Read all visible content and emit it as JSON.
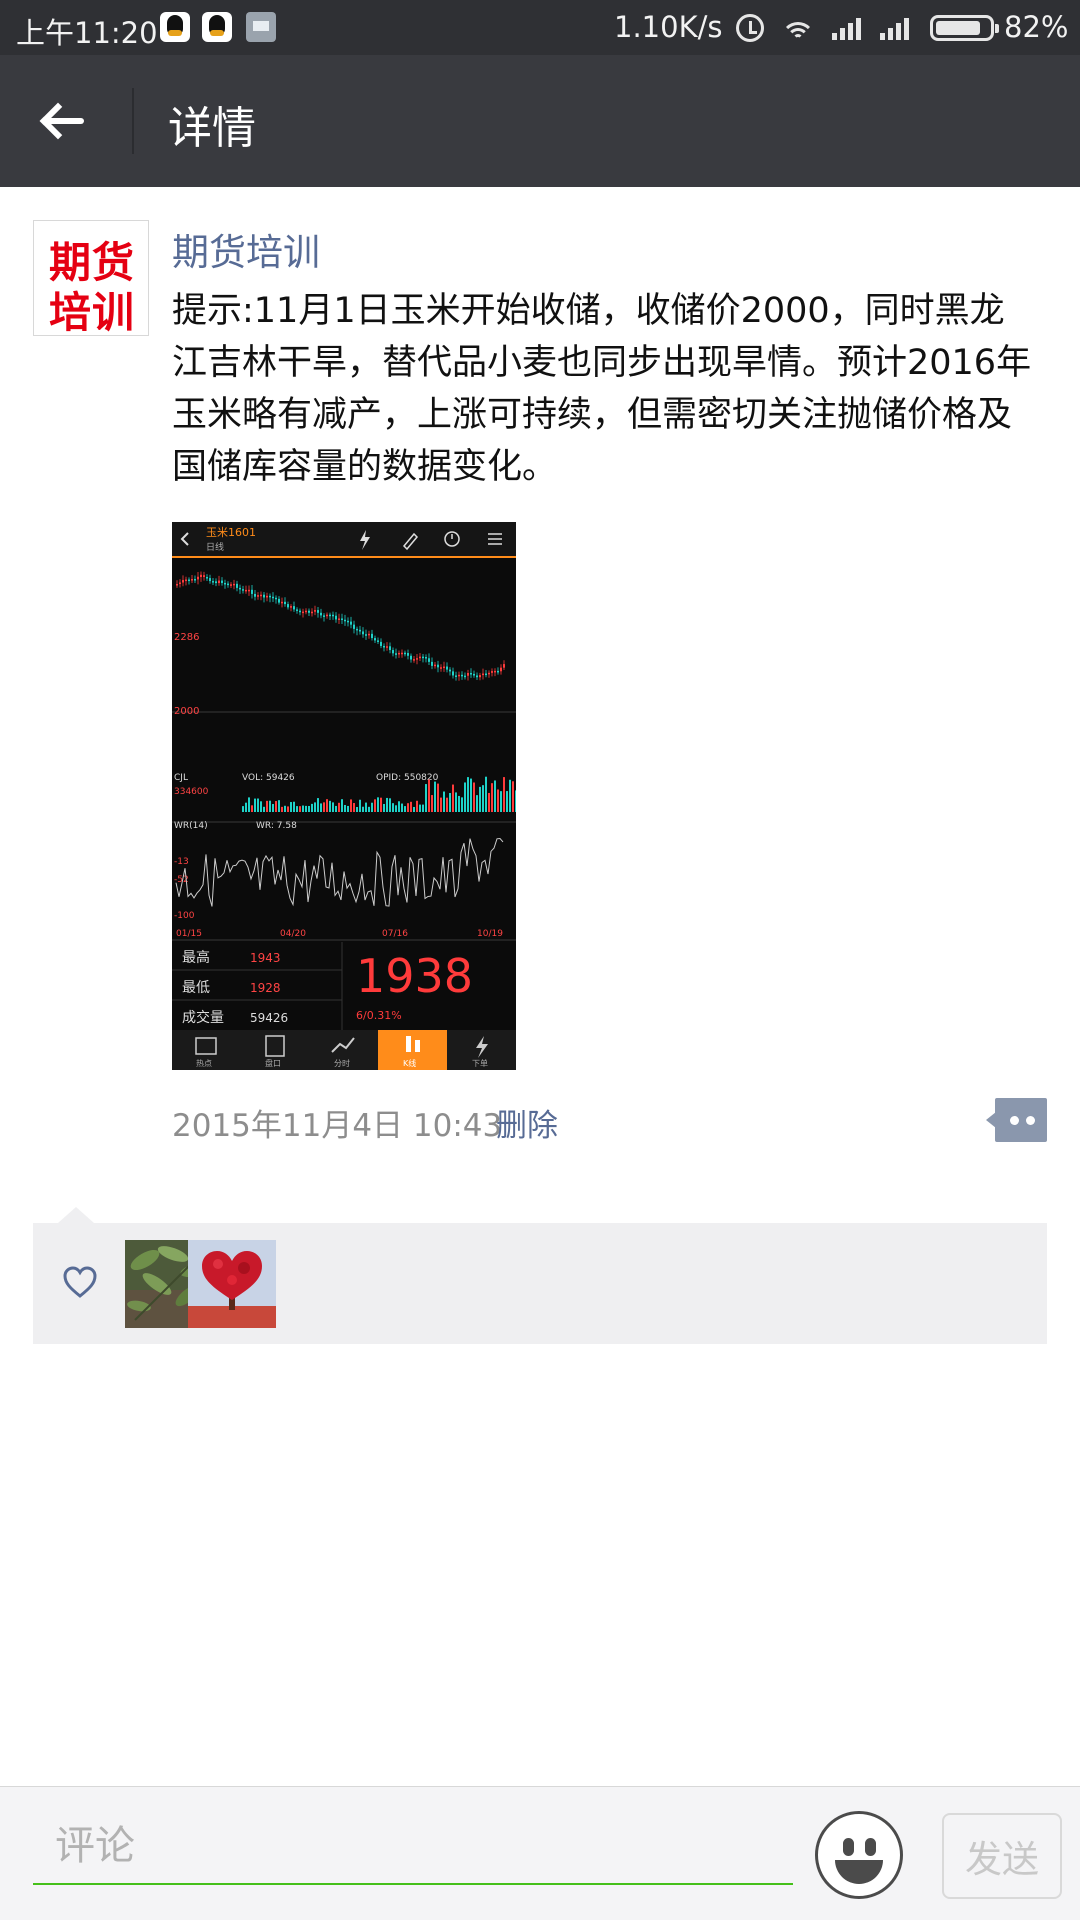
{
  "status_bar": {
    "time": "上午11:20",
    "network_speed": "1.10K/s",
    "battery_percent": "82%",
    "icons": [
      "qq-icon",
      "qq-icon",
      "message-icon",
      "alarm-icon",
      "wifi-icon",
      "signal-icon",
      "signal-icon",
      "battery-icon"
    ]
  },
  "header": {
    "back_icon": "arrow-left-icon",
    "title": "详情"
  },
  "post": {
    "avatar": {
      "line1": "期货",
      "line2": "培训"
    },
    "author": "期货培训",
    "text": "提示:11月1日玉米开始收储，收储价2000，同时黑龙江吉林干旱，替代品小麦也同步出现旱情。预计2016年玉米略有减产，上涨可持续，但需密切关注抛储价格及国储库容量的数据变化。",
    "image": {
      "header_title": "玉米1601",
      "header_sub": "日线",
      "price_labels": [
        "2286",
        "2000"
      ],
      "vol_text": "VOL: 59426",
      "opid_text": "OPID: 550820",
      "cjl_label": "CJL",
      "cjl_value": "334600",
      "wr_label": "WR(14)",
      "wr_text": "WR: 7.58",
      "wr_ticks": [
        "-13",
        "-52",
        "-100"
      ],
      "date_ticks": [
        "01/15",
        "04/20",
        "07/16",
        "10/19"
      ],
      "stats": [
        {
          "label": "最高",
          "value": "1943"
        },
        {
          "label": "最低",
          "value": "1928"
        },
        {
          "label": "成交量",
          "value": "59426"
        }
      ],
      "last_price": "1938",
      "change": "6/0.31%",
      "tabs": [
        "热点",
        "盘口",
        "分时",
        "K线",
        "下单"
      ],
      "active_tab": "K线",
      "accent_color": "#ff8c1a",
      "up_color": "#ff3b3b",
      "down_color": "#1ed3c9"
    },
    "date": "2015年11月4日 10:43",
    "delete_label": "删除",
    "comment_icon": "comment-dots-icon"
  },
  "likes": {
    "icon": "heart-outline-icon",
    "users": [
      "liker-avatar-leaves",
      "liker-avatar-heart-tree"
    ]
  },
  "comment_bar": {
    "placeholder": "评论",
    "emoji_icon": "smiley-icon",
    "send_label": "发送",
    "input_underline_color": "#45c01a"
  },
  "colors": {
    "header_bg": "#393a3f",
    "link": "#576b95",
    "likes_bg": "#efeff1"
  }
}
